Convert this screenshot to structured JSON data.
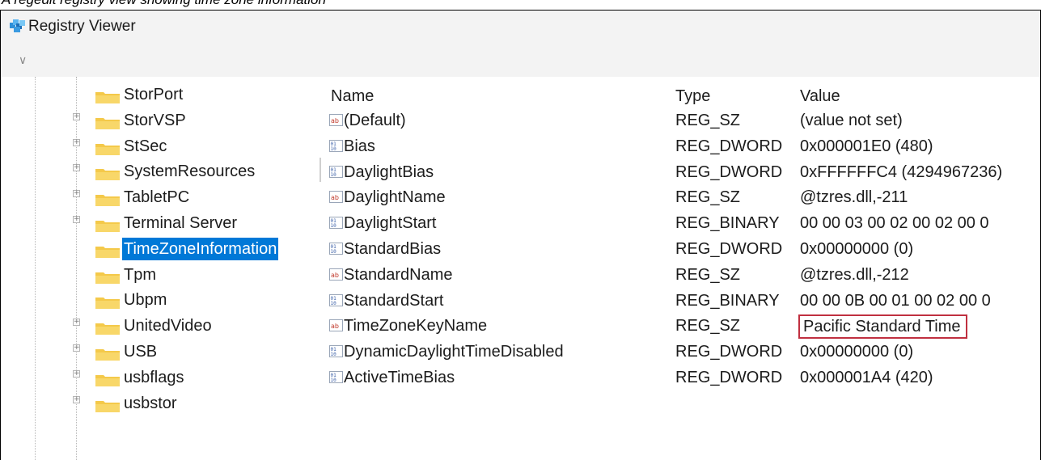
{
  "caption": "A regedit registry view showing time zone information",
  "window": {
    "title": "Registry Viewer"
  },
  "tree": {
    "items": [
      {
        "label": "StorPort",
        "expandable": false,
        "selected": false
      },
      {
        "label": "StorVSP",
        "expandable": true,
        "selected": false
      },
      {
        "label": "StSec",
        "expandable": true,
        "selected": false
      },
      {
        "label": "SystemResources",
        "expandable": true,
        "selected": false
      },
      {
        "label": "TabletPC",
        "expandable": true,
        "selected": false
      },
      {
        "label": "Terminal Server",
        "expandable": true,
        "selected": false
      },
      {
        "label": "TimeZoneInformation",
        "expandable": false,
        "selected": true
      },
      {
        "label": "Tpm",
        "expandable": false,
        "selected": false
      },
      {
        "label": "Ubpm",
        "expandable": false,
        "selected": false
      },
      {
        "label": "UnitedVideo",
        "expandable": true,
        "selected": false
      },
      {
        "label": "USB",
        "expandable": true,
        "selected": false
      },
      {
        "label": "usbflags",
        "expandable": true,
        "selected": false
      },
      {
        "label": "usbstor",
        "expandable": true,
        "selected": false
      }
    ]
  },
  "list": {
    "columns": {
      "name": "Name",
      "type": "Type",
      "value": "Value"
    },
    "rows": [
      {
        "name": "(Default)",
        "type": "REG_SZ",
        "value": "(value not set)",
        "icon": "string-value-icon",
        "highlighted": false
      },
      {
        "name": "Bias",
        "type": "REG_DWORD",
        "value": "0x000001E0 (480)",
        "icon": "binary-value-icon",
        "highlighted": false
      },
      {
        "name": "DaylightBias",
        "type": "REG_DWORD",
        "value": "0xFFFFFFC4 (4294967236)",
        "icon": "binary-value-icon",
        "highlighted": false
      },
      {
        "name": "DaylightName",
        "type": "REG_SZ",
        "value": "@tzres.dll,-211",
        "icon": "string-value-icon",
        "highlighted": false
      },
      {
        "name": "DaylightStart",
        "type": "REG_BINARY",
        "value": "00 00 03 00 02 00 02 00 0",
        "icon": "binary-value-icon",
        "highlighted": false
      },
      {
        "name": "StandardBias",
        "type": "REG_DWORD",
        "value": "0x00000000 (0)",
        "icon": "binary-value-icon",
        "highlighted": false
      },
      {
        "name": "StandardName",
        "type": "REG_SZ",
        "value": "@tzres.dll,-212",
        "icon": "string-value-icon",
        "highlighted": false
      },
      {
        "name": "StandardStart",
        "type": "REG_BINARY",
        "value": "00 00 0B 00 01 00 02 00 0",
        "icon": "binary-value-icon",
        "highlighted": false
      },
      {
        "name": "TimeZoneKeyName",
        "type": "REG_SZ",
        "value": "Pacific Standard Time",
        "icon": "string-value-icon",
        "highlighted": true
      },
      {
        "name": "DynamicDaylightTimeDisabled",
        "type": "REG_DWORD",
        "value": "0x00000000 (0)",
        "icon": "binary-value-icon",
        "highlighted": false
      },
      {
        "name": "ActiveTimeBias",
        "type": "REG_DWORD",
        "value": "0x000001A4 (420)",
        "icon": "binary-value-icon",
        "highlighted": false
      }
    ]
  },
  "colors": {
    "selection": "#0078d7",
    "highlight_border": "#c03040",
    "folder": "#f4c94a"
  }
}
